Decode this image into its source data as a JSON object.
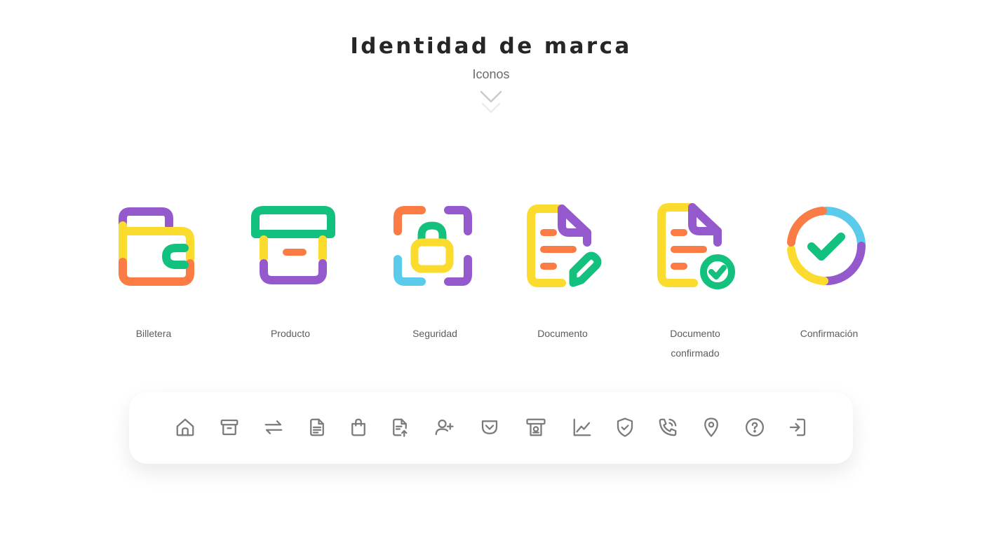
{
  "header": {
    "title": "Identidad de marca",
    "subtitle": "Iconos"
  },
  "colors": {
    "purple": "#9459CD",
    "yellow": "#FBDB2E",
    "orange": "#FB7B45",
    "green": "#12C17E",
    "cyan": "#5ACBEA",
    "gray_icon": "#7a7a7a",
    "title": "#262626"
  },
  "brand_icons": [
    {
      "icon": "wallet-icon",
      "label": "Billetera"
    },
    {
      "icon": "product-box-icon",
      "label": "Producto"
    },
    {
      "icon": "security-lock-icon",
      "label": "Seguridad"
    },
    {
      "icon": "document-edit-icon",
      "label": "Documento"
    },
    {
      "icon": "document-check-icon",
      "label_line1": "Documento",
      "label_line2": "confirmado"
    },
    {
      "icon": "check-circle-icon",
      "label": "Confirmación"
    }
  ],
  "toolbar_icons": [
    "home-icon",
    "archive-icon",
    "transfer-arrows-icon",
    "document-icon",
    "shopping-bag-icon",
    "document-upload-icon",
    "add-user-icon",
    "pocket-icon",
    "atm-cash-icon",
    "line-chart-icon",
    "shield-check-icon",
    "phone-call-icon",
    "location-pin-icon",
    "help-circle-icon",
    "logout-icon"
  ]
}
